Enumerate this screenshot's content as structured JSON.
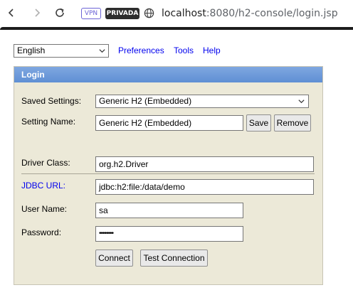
{
  "browser": {
    "vpn_badge": "VPN",
    "private_badge": "PRIVADA",
    "url_host": "localhost",
    "url_rest": ":8080/h2-console/login.jsp"
  },
  "topbar": {
    "language": "English",
    "preferences": "Preferences",
    "tools": "Tools",
    "help": "Help"
  },
  "login": {
    "title": "Login",
    "saved_settings_label": "Saved Settings:",
    "saved_settings_value": "Generic H2 (Embedded)",
    "setting_name_label": "Setting Name:",
    "setting_name_value": "Generic H2 (Embedded)",
    "save_button": "Save",
    "remove_button": "Remove",
    "driver_class_label": "Driver Class:",
    "driver_class_value": "org.h2.Driver",
    "jdbc_url_label": "JDBC URL:",
    "jdbc_url_value": "jdbc:h2:file:/data/demo",
    "user_name_label": "User Name:",
    "user_name_value": "sa",
    "password_label": "Password:",
    "password_value": "••••••••",
    "connect_button": "Connect",
    "test_connection_button": "Test Connection"
  },
  "colors": {
    "panel_bg": "#ece9d8",
    "header_blue": "#6b97d8",
    "link_blue": "#0000ee",
    "vpn_purple": "#6b63d6"
  },
  "icons": [
    "back-arrow-icon",
    "forward-arrow-icon",
    "reload-icon",
    "globe-icon",
    "chevron-down-icon"
  ]
}
